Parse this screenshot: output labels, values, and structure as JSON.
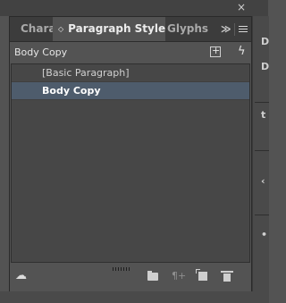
{
  "window_edge": {
    "close_glyph": "×"
  },
  "tabs": [
    {
      "label": "Characte",
      "active": false
    },
    {
      "label": "Paragraph Styles",
      "active": true,
      "arrows": "◇"
    },
    {
      "label": "Glyphs",
      "active": false
    }
  ],
  "tabbar": {
    "overflow_label": "≫",
    "menu_icon": "hamburger-menu-icon"
  },
  "header": {
    "current_style": "Body Copy",
    "new_group_icon": "new-style-group-icon",
    "quick_apply_glyph": "ϟ"
  },
  "styles_list": [
    {
      "label": "[Basic Paragraph]",
      "selected": false
    },
    {
      "label": "Body Copy",
      "selected": true
    }
  ],
  "footer": {
    "cloud_glyph": "☁",
    "clear_overrides_glyph": "¶+",
    "icons": [
      "cloud-library-icon",
      "folder-icon",
      "clear-overrides-icon",
      "new-style-icon",
      "trash-icon"
    ]
  },
  "right_strip": {
    "glyphs": [
      "D",
      "D",
      "t",
      "‹",
      "•"
    ]
  },
  "colors": {
    "panel": "#535353",
    "tabbar": "#3c3c3c",
    "selection": "#4e5c6c",
    "list": "#474747"
  }
}
